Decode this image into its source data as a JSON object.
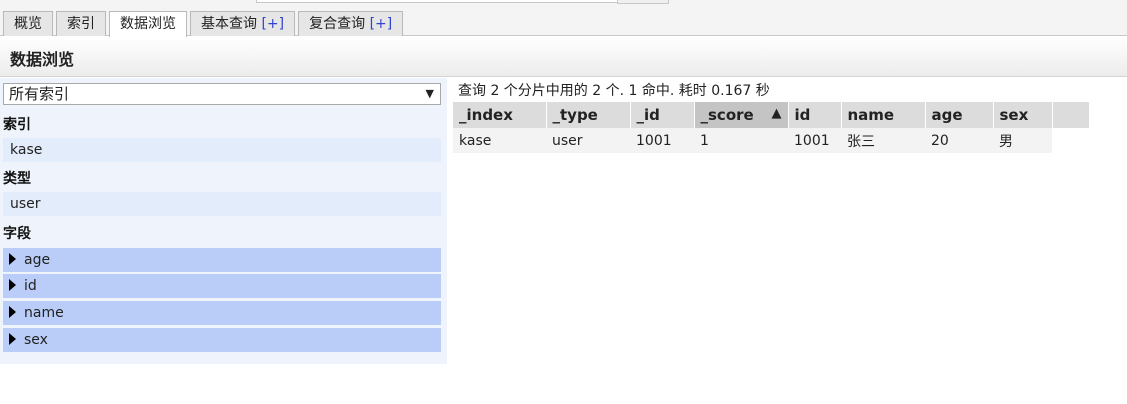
{
  "tabs": [
    {
      "label": "概览",
      "plus": ""
    },
    {
      "label": "索引",
      "plus": ""
    },
    {
      "label": "数据浏览",
      "plus": ""
    },
    {
      "label": "基本查询 ",
      "plus": "[+]"
    },
    {
      "label": "复合查询 ",
      "plus": "[+]"
    }
  ],
  "page_title": "数据浏览",
  "left": {
    "index_select": "所有索引",
    "index_label": "索引",
    "index_value": "kase",
    "type_label": "类型",
    "type_value": "user",
    "fields_label": "字段",
    "fields": [
      "age",
      "id",
      "name",
      "sex"
    ]
  },
  "summary": "查询 2 个分片中用的 2 个. 1 命中. 耗时 0.167 秒",
  "table": {
    "headers": [
      "_index",
      "_type",
      "_id",
      "_score",
      "id",
      "name",
      "age",
      "sex"
    ],
    "sort_indicator": "▲",
    "rows": [
      [
        "kase",
        "user",
        "1001",
        "1",
        "1001",
        "张三",
        "20",
        "男"
      ]
    ]
  }
}
